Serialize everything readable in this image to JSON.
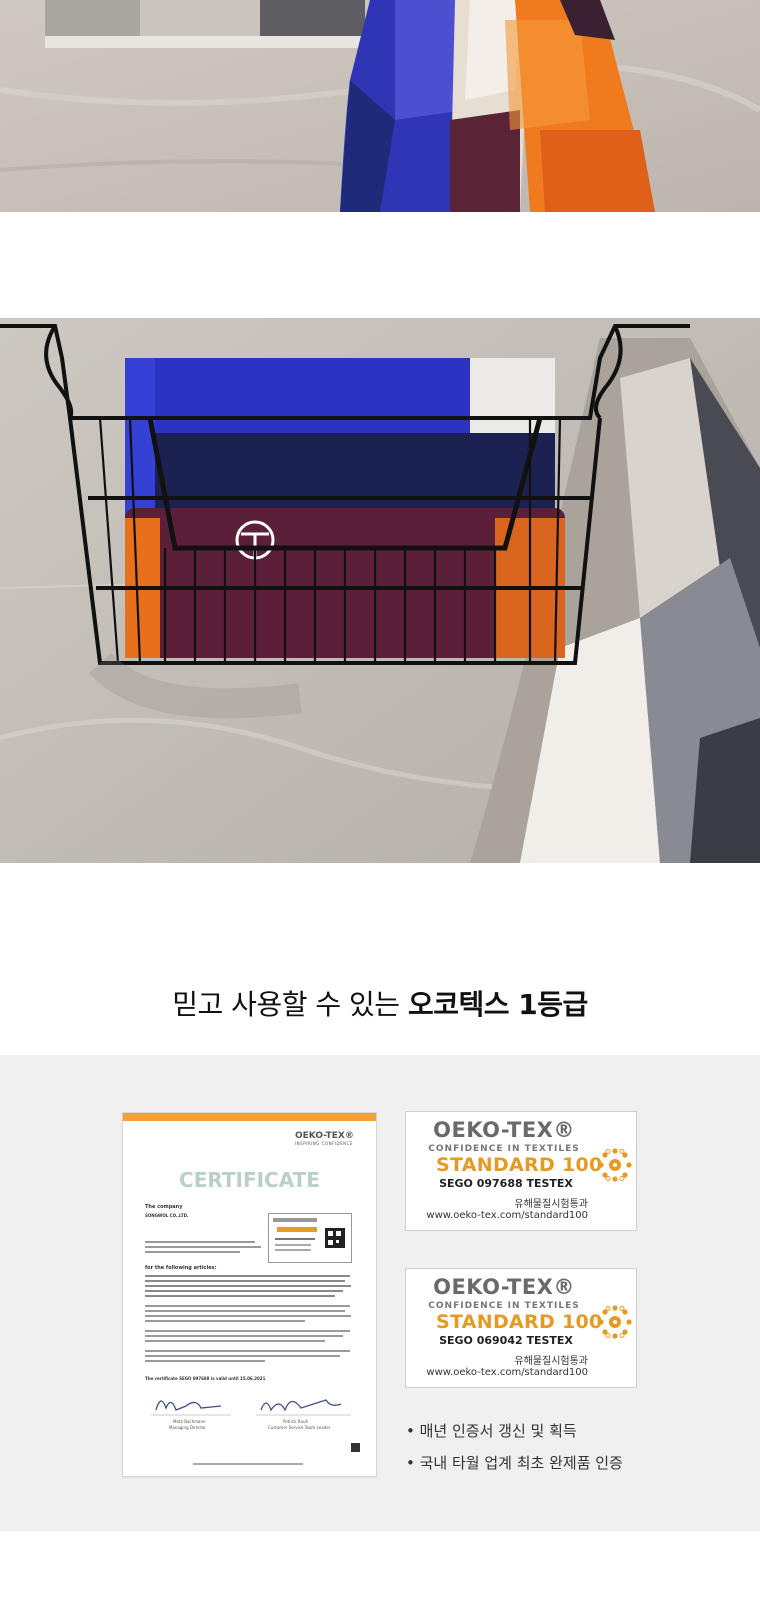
{
  "headline": {
    "normal": "믿고 사용할 수 있는 ",
    "bold": "오코텍스 1등급"
  },
  "certificate": {
    "brand": "OEKO-TEX®",
    "tagline": "INSPIRING CONFIDENCE",
    "title": "CERTIFICATE",
    "company_label": "The company",
    "company_name": "SONGWOL CO.,LTD.",
    "following": "for the following articles:",
    "validity": "The certificate SEGO 097688 is valid until 15.06.2021",
    "signer1_name": "Meta Bachmann",
    "signer1_role": "Managing Director",
    "signer2_name": "Patrick Rauh",
    "signer2_role": "Customer Service Team Leader"
  },
  "badges": [
    {
      "brand": "OEKO-TEX®",
      "confidence": "CONFIDENCE IN TEXTILES",
      "standard": "STANDARD 100",
      "number": "SEGO 097688 TESTEX",
      "korean": "유해물질시험통과",
      "url": "www.oeko-tex.com/standard100"
    },
    {
      "brand": "OEKO-TEX®",
      "confidence": "CONFIDENCE IN TEXTILES",
      "standard": "STANDARD 100",
      "number": "SEGO 069042 TESTEX",
      "korean": "유해물질시험통과",
      "url": "www.oeko-tex.com/standard100"
    }
  ],
  "bullets": [
    "• 매년 인증서 갱신 및 획득",
    "• 국내 타월 업계 최초 완제품 인증"
  ],
  "colors": {
    "accent_orange": "#e69a23",
    "section_bg": "#f0f0f0",
    "towel_blue": "#3a3bb5",
    "towel_navy": "#1f2347",
    "towel_plum": "#5c1f3a",
    "towel_orange": "#e8701c"
  },
  "icons": {
    "sun": "oeko-tex-sun-icon",
    "towel_logo": "circle-logo-icon"
  }
}
